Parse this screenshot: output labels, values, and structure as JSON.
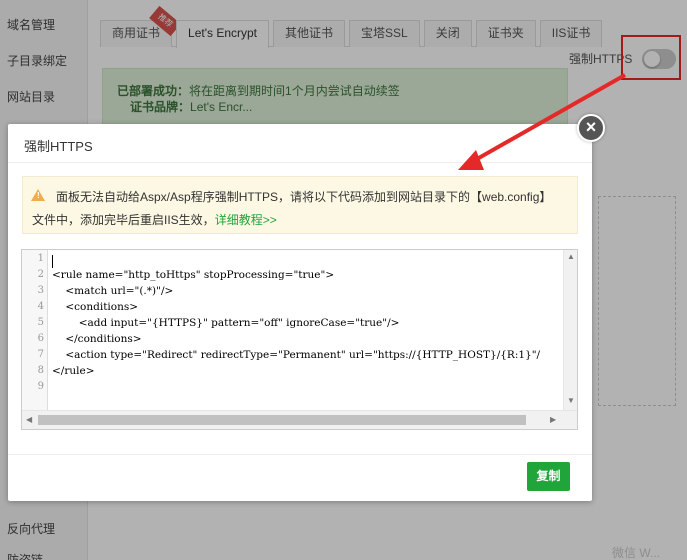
{
  "sidebar": {
    "items": [
      "域名管理",
      "子目录绑定",
      "网站目录"
    ],
    "bottom_item": "反向代理",
    "bottom_item_partial": "防盗链"
  },
  "tabs": [
    {
      "label": "商用证书",
      "active": false,
      "badge": "推荐"
    },
    {
      "label": "Let's Encrypt",
      "active": true
    },
    {
      "label": "其他证书",
      "active": false
    },
    {
      "label": "宝塔SSL",
      "active": false
    },
    {
      "label": "关闭",
      "active": false
    },
    {
      "label": "证书夹",
      "active": false
    },
    {
      "label": "IIS证书",
      "active": false
    }
  ],
  "https_toggle": {
    "label": "强制HTTPS",
    "state": "off"
  },
  "success": {
    "line1_bold": "已部署成功：",
    "line1": "将在距离到期时间1个月内尝试自动续签",
    "line2_label": "证书品牌：",
    "line2_value": "Let's Encr..."
  },
  "modal": {
    "title": "强制HTTPS",
    "warning_line1": "面板无法自动给Aspx/Asp程序强制HTTPS，请将以下代码添加到网站目录下的【web.config】",
    "warning_line2": "文件中，添加完毕后重启IIS生效，",
    "warning_link": "详细教程>>",
    "code_lines": [
      "",
      "<rule name=\"http_toHttps\" stopProcessing=\"true\">",
      "    <match url=\"(.*)\"/>",
      "    <conditions>",
      "        <add input=\"{HTTPS}\" pattern=\"off\" ignoreCase=\"true\"/>",
      "    </conditions>",
      "    <action type=\"Redirect\" redirectType=\"Permanent\" url=\"https://{HTTP_HOST}/{R:1}\"/",
      "</rule>",
      "",
      ""
    ],
    "line_numbers": [
      "1",
      "2",
      "3",
      "4",
      "5",
      "6",
      "7",
      "8",
      "9"
    ],
    "copy_button": "复制"
  },
  "watermark": "微信 W...",
  "colors": {
    "accent_green": "#20a53a",
    "annotation_red": "#e52929",
    "warn_orange": "#f0ad4e"
  }
}
